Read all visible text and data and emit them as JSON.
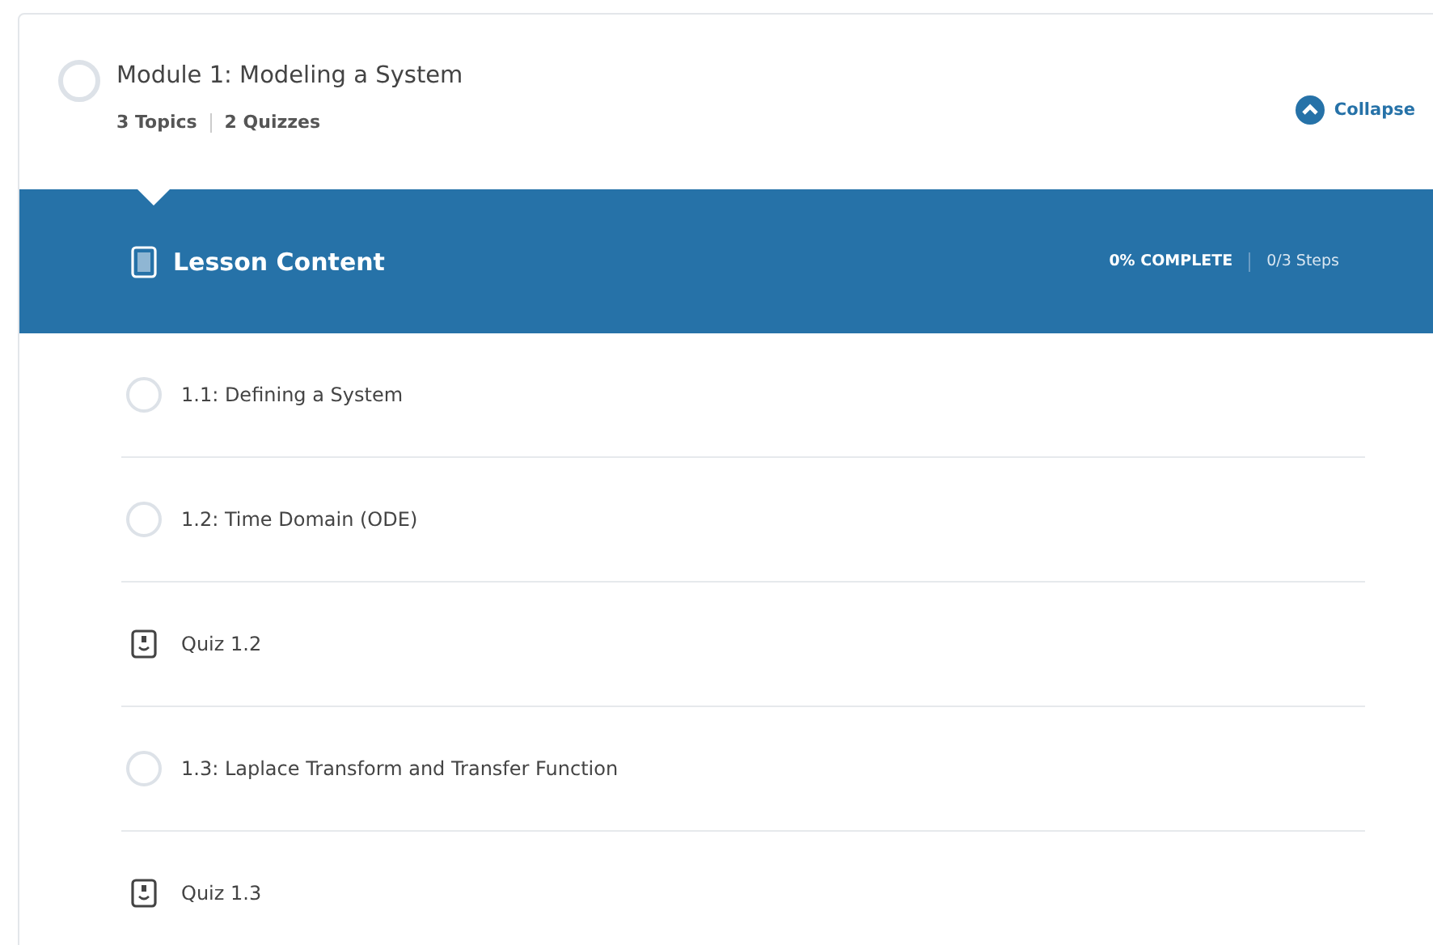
{
  "module": {
    "title": "Module 1: Modeling a System",
    "completed": false,
    "topics": "3 Topics",
    "quizzes": "2 Quizzes",
    "toggle": "Collapse",
    "expanded": true
  },
  "lesson": {
    "title": "Lesson Content",
    "progress": "0% COMPLETE",
    "steps": "0/3 Steps"
  },
  "items": [
    {
      "kind": "topic",
      "label": "1.1: Defining a System",
      "completed": false
    },
    {
      "kind": "topic",
      "label": "1.2: Time Domain (ODE)",
      "completed": false
    },
    {
      "kind": "quiz",
      "label": "Quiz 1.2"
    },
    {
      "kind": "topic",
      "label": "1.3: Laplace Transform and Transfer Function",
      "completed": false
    },
    {
      "kind": "quiz",
      "label": "Quiz 1.3"
    }
  ]
}
